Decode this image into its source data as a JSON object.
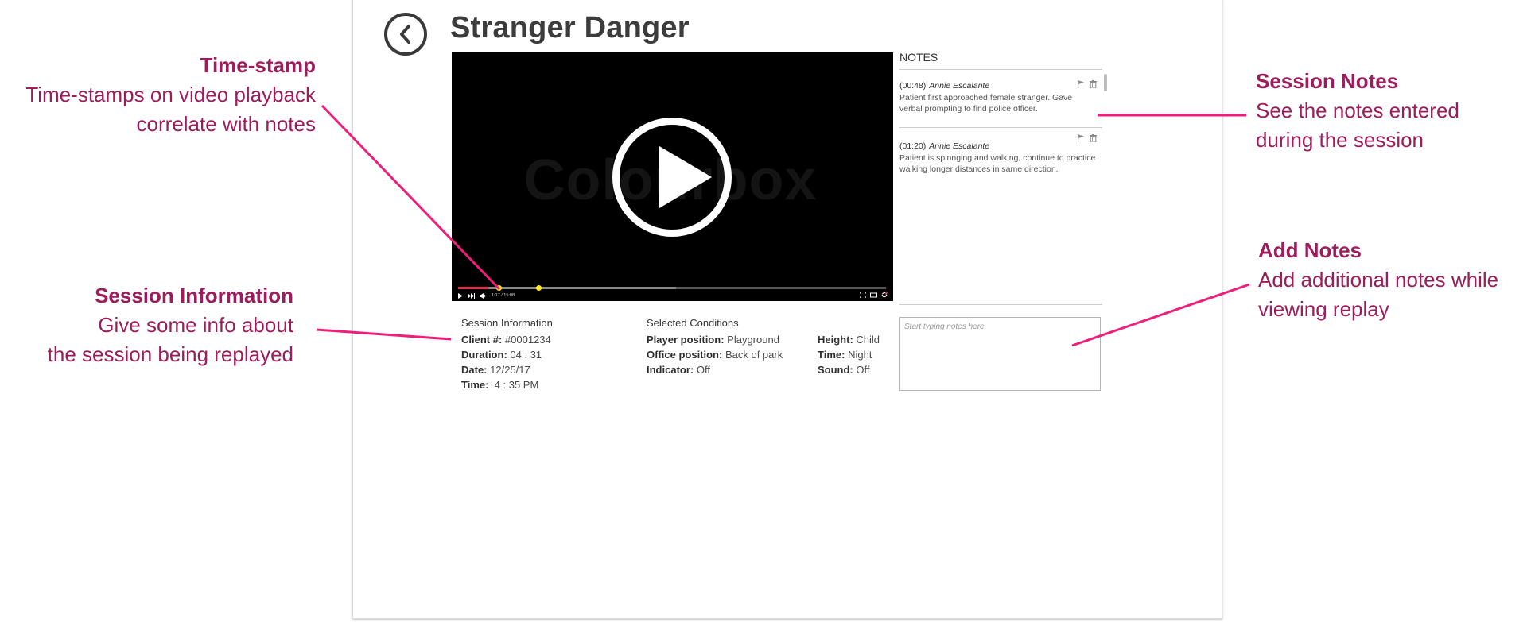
{
  "app": {
    "title": "Stranger Danger",
    "back_icon": "chevron-left-icon"
  },
  "video": {
    "watermark": "Colourbox",
    "timestamp": "1:17 / 15:08",
    "played_fraction": 0.07,
    "buffered_fraction": 0.51,
    "note_markers": [
      0.095,
      0.188
    ],
    "colors": {
      "played": "#e8294a",
      "marker": "#ffe81a"
    }
  },
  "notes": {
    "heading": "NOTES",
    "items": [
      {
        "time": "(00:48)",
        "author": "Annie Escalante",
        "text": "Patient first approached female stranger.  Gave verbal prompting to find police officer."
      },
      {
        "time": "(01:20)",
        "author": "Annie Escalante",
        "text": "Patient is spinnging and walking, continue to practice walking longer distances in same direction."
      }
    ],
    "add_placeholder": "Start typing notes here"
  },
  "session_info": {
    "heading": "Session Information",
    "rows": [
      {
        "label": "Client #:",
        "value": "#0001234"
      },
      {
        "label": "Duration:",
        "value": "04 : 31"
      },
      {
        "label": "Date:",
        "value": "12/25/17"
      },
      {
        "label": "Time:",
        "value": " 4 : 35 PM"
      }
    ]
  },
  "conditions": {
    "heading": "Selected Conditions",
    "col1": [
      {
        "label": "Player position:",
        "value": "Playground"
      },
      {
        "label": "Office position:",
        "value": "Back of park"
      },
      {
        "label": "Indicator:",
        "value": "Off"
      }
    ],
    "col2": [
      {
        "label": "Height:",
        "value": "Child"
      },
      {
        "label": "Time:",
        "value": "Night"
      },
      {
        "label": "Sound:",
        "value": "Off"
      }
    ]
  },
  "annotations": {
    "timestamp": {
      "title": "Time-stamp",
      "lines": [
        "Time-stamps on video playback",
        "correlate with notes"
      ]
    },
    "session_info": {
      "title": "Session Information",
      "lines": [
        "Give some info about",
        "the session being replayed"
      ]
    },
    "session_notes": {
      "title": "Session Notes",
      "lines": [
        "See the notes entered",
        "during the session"
      ]
    },
    "add_notes": {
      "title": "Add Notes",
      "lines": [
        "Add additional notes while",
        "viewing replay"
      ]
    },
    "colors": {
      "text": "#9b1d5b",
      "line": "#ee1f7a"
    }
  }
}
